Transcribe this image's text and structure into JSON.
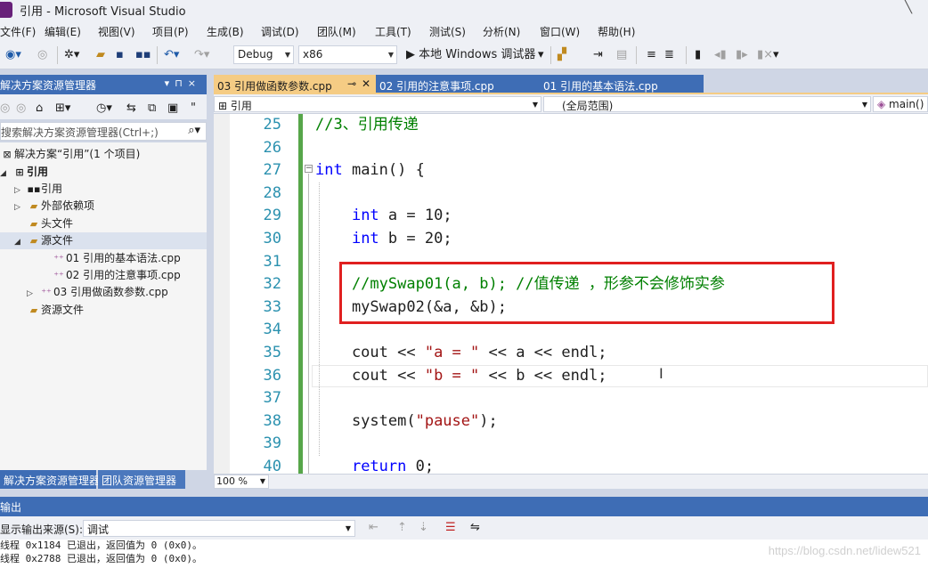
{
  "window": {
    "title": "引用 - Microsoft Visual Studio"
  },
  "menu": [
    "文件(F)",
    "编辑(E)",
    "视图(V)",
    "项目(P)",
    "生成(B)",
    "调试(D)",
    "团队(M)",
    "工具(T)",
    "测试(S)",
    "分析(N)",
    "窗口(W)",
    "帮助(H)"
  ],
  "toolbar": {
    "config": "Debug",
    "platform": "x86",
    "run_label": "▶ 本地 Windows 调试器"
  },
  "solution_explorer": {
    "title": "解决方案资源管理器",
    "search_placeholder": "搜索解决方案资源管理器(Ctrl+;)",
    "tree": [
      {
        "label": "解决方案“引用”(1 个项目)",
        "level": 0
      },
      {
        "label": "引用",
        "level": 1
      },
      {
        "label": "引用",
        "level": 2
      },
      {
        "label": "外部依赖项",
        "level": 2
      },
      {
        "label": "头文件",
        "level": 2
      },
      {
        "label": "源文件",
        "level": 2
      },
      {
        "label": "01 引用的基本语法.cpp",
        "level": 3
      },
      {
        "label": "02 引用的注意事项.cpp",
        "level": 3
      },
      {
        "label": "03 引用做函数参数.cpp",
        "level": 3
      },
      {
        "label": "资源文件",
        "level": 2
      }
    ],
    "tabs": [
      "解决方案资源管理器",
      "团队资源管理器"
    ]
  },
  "editor": {
    "tabs": [
      "03 引用做函数参数.cpp",
      "02 引用的注意事项.cpp",
      "01 引用的基本语法.cpp"
    ],
    "nav_project": "引用",
    "nav_scope": "(全局范围)",
    "nav_member": "main()",
    "zoom": "100 %",
    "lines": [
      {
        "num": "25",
        "segs": [
          {
            "t": "//3、引用传递",
            "c": "cm"
          }
        ]
      },
      {
        "num": "26",
        "segs": []
      },
      {
        "num": "27",
        "segs": [
          {
            "t": "int",
            "c": "kw"
          },
          {
            "t": " main() {",
            "c": ""
          }
        ]
      },
      {
        "num": "28",
        "segs": []
      },
      {
        "num": "29",
        "segs": [
          {
            "t": "    ",
            "c": ""
          },
          {
            "t": "int",
            "c": "kw"
          },
          {
            "t": " a = 10;",
            "c": ""
          }
        ]
      },
      {
        "num": "30",
        "segs": [
          {
            "t": "    ",
            "c": ""
          },
          {
            "t": "int",
            "c": "kw"
          },
          {
            "t": " b = 20;",
            "c": ""
          }
        ]
      },
      {
        "num": "31",
        "segs": []
      },
      {
        "num": "32",
        "segs": [
          {
            "t": "    //mySwap01(a, b); //值传递 ，形参不会修饰实参",
            "c": "cm"
          }
        ]
      },
      {
        "num": "33",
        "segs": [
          {
            "t": "    mySwap02(&a, &b);",
            "c": ""
          }
        ]
      },
      {
        "num": "34",
        "segs": []
      },
      {
        "num": "35",
        "segs": [
          {
            "t": "    cout << ",
            "c": ""
          },
          {
            "t": "\"a = \"",
            "c": "st"
          },
          {
            "t": " << a << endl;",
            "c": ""
          }
        ]
      },
      {
        "num": "36",
        "segs": [
          {
            "t": "    cout << ",
            "c": ""
          },
          {
            "t": "\"b = \"",
            "c": "st"
          },
          {
            "t": " << b << endl;",
            "c": ""
          }
        ]
      },
      {
        "num": "37",
        "segs": []
      },
      {
        "num": "38",
        "segs": [
          {
            "t": "    system(",
            "c": ""
          },
          {
            "t": "\"pause\"",
            "c": "st"
          },
          {
            "t": ");",
            "c": ""
          }
        ]
      },
      {
        "num": "39",
        "segs": []
      },
      {
        "num": "40",
        "segs": [
          {
            "t": "    ",
            "c": ""
          },
          {
            "t": "return",
            "c": "kw"
          },
          {
            "t": " 0;",
            "c": ""
          }
        ]
      }
    ]
  },
  "output": {
    "title": "输出",
    "source_label": "显示输出来源(S):",
    "source_value": "调试",
    "lines": [
      "线程 0x1184 已退出，返回值为 0 (0x0)。",
      "线程 0x2788 已退出，返回值为 0 (0x0)。"
    ]
  },
  "watermark": "https://blog.csdn.net/lidew521"
}
